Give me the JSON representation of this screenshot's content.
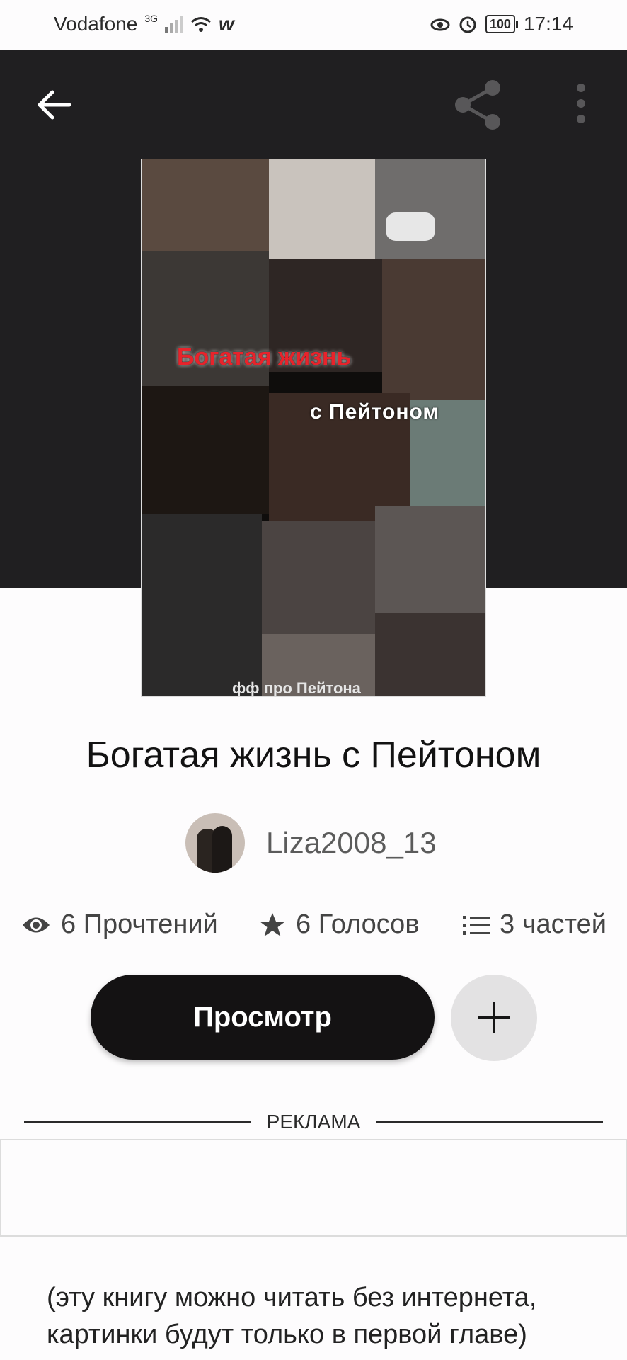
{
  "status_bar": {
    "carrier": "Vodafone",
    "network": "3G",
    "battery": "100",
    "time": "17:14"
  },
  "book": {
    "cover": {
      "title_line1": "Богатая жизнь",
      "title_line2": "с Пейтоном",
      "footer": "фф про Пейтона"
    },
    "title": "Богатая жизнь с Пейтоном",
    "author": "Liza2008_13",
    "stats": {
      "reads": "6 Прочтений",
      "votes": "6 Голосов",
      "parts": "3 частей"
    },
    "read_button": "Просмотр",
    "description": "(эту книгу можно читать без интернета, картинки будут только в первой главе)"
  },
  "ad": {
    "label": "РЕКЛАМА"
  },
  "icons": {
    "back": "arrow-left-icon",
    "share": "share-icon",
    "more": "more-vertical-icon",
    "reads": "eye-icon",
    "votes": "star-icon",
    "parts": "list-icon",
    "add": "plus-icon"
  }
}
